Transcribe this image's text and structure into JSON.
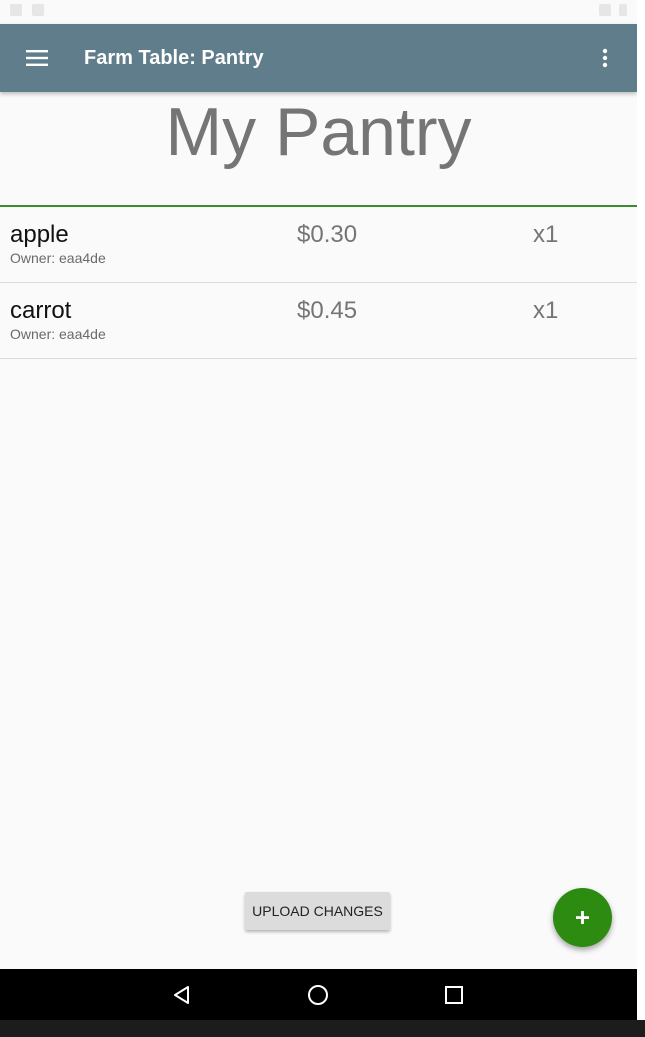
{
  "app_bar": {
    "title": "Farm Table: Pantry",
    "color": "#607d8b"
  },
  "page": {
    "heading": "My Pantry"
  },
  "pantry": {
    "items": [
      {
        "name": "apple",
        "owner": "Owner: eaa4de",
        "price": "$0.30",
        "quantity": "x1"
      },
      {
        "name": "carrot",
        "owner": "Owner: eaa4de",
        "price": "$0.45",
        "quantity": "x1"
      }
    ]
  },
  "actions": {
    "upload_label": "UPLOAD CHANGES",
    "fab_icon": "plus-icon",
    "fab_color": "#2e8b12"
  },
  "icons": {
    "menu": "hamburger-menu-icon",
    "overflow": "more-vert-icon",
    "back": "back-triangle-icon",
    "home": "home-circle-icon",
    "recents": "recents-square-icon"
  }
}
